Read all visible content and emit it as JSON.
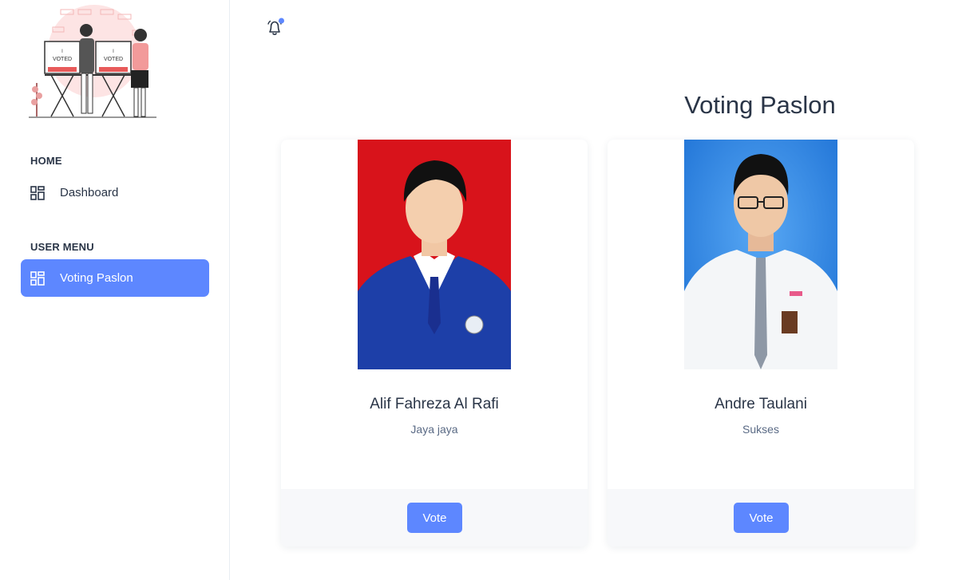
{
  "sidebar": {
    "sections": [
      {
        "label": "HOME",
        "items": [
          {
            "label": "Dashboard",
            "icon": "dashboard-icon",
            "active": false
          }
        ]
      },
      {
        "label": "USER MENU",
        "items": [
          {
            "label": "Voting Paslon",
            "icon": "dashboard-icon",
            "active": true
          }
        ]
      }
    ]
  },
  "header": {
    "notification_icon": "bell-icon",
    "has_unread": true
  },
  "main": {
    "title": "Voting Paslon",
    "candidates": [
      {
        "name": "Alif Fahreza Al Rafi",
        "motto": "Jaya jaya",
        "vote_label": "Vote",
        "photo_bg": "#d8131b",
        "uniform": "#1d3fa8"
      },
      {
        "name": "Andre Taulani",
        "motto": "Sukses",
        "vote_label": "Vote",
        "photo_bg": "#2f88e6",
        "uniform": "#f4f6f8"
      }
    ]
  },
  "colors": {
    "primary": "#5d87ff",
    "text": "#2a3547",
    "muted": "#5a6a85"
  }
}
